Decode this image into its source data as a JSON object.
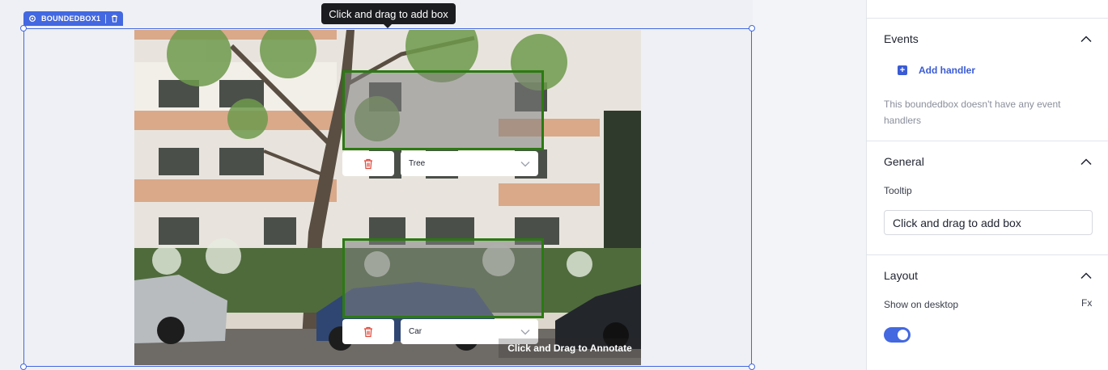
{
  "canvas": {
    "widget_badge": {
      "name": "BOUNDEDBOX1",
      "settings_icon": "gear-icon",
      "delete_icon": "trash-icon"
    },
    "tooltip_text": "Click and drag to add box",
    "image_hint": "Click and Drag to Annotate",
    "annotations": [
      {
        "label": "Tree",
        "delete_icon": "trash-icon",
        "dropdown_icon": "chevron-down-icon"
      },
      {
        "label": "Car",
        "delete_icon": "trash-icon",
        "dropdown_icon": "chevron-down-icon"
      }
    ],
    "box_color": "#2b7a12",
    "delete_color": "#e0483a"
  },
  "panel": {
    "events": {
      "title": "Events",
      "add_handler": "Add handler",
      "empty_text": "This boundedbox doesn't have any event handlers"
    },
    "general": {
      "title": "General",
      "tooltip_label": "Tooltip",
      "tooltip_value": "Click and drag to add box"
    },
    "layout": {
      "title": "Layout",
      "show_on_desktop_label": "Show on desktop",
      "fx_label": "Fx",
      "show_on_desktop": true
    },
    "accent_color": "#4368e0"
  }
}
